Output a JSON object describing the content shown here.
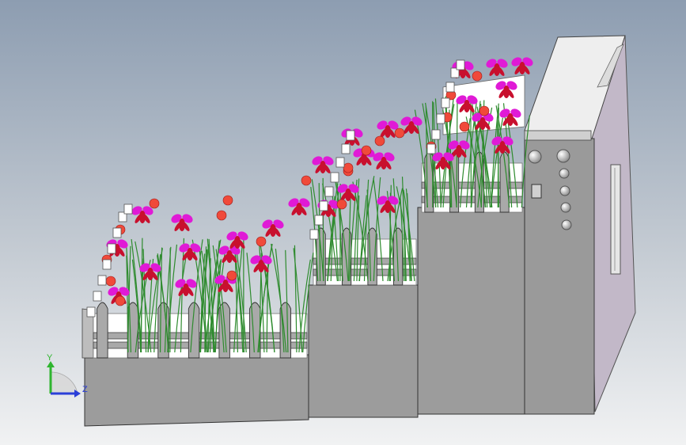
{
  "viewport": {
    "background_top": "#8d9db1",
    "background_bottom": "#f1f2f3"
  },
  "triad": {
    "y_label": "Y",
    "z_label": "Z",
    "y_color": "#2fb52f",
    "z_color": "#2a3fd8"
  },
  "model": {
    "body_color": "#9a9a9a",
    "face_dark_color": "#6f6f6f",
    "panel_color": "#eaeaea",
    "side_color": "#c2b8c8",
    "fence_color": "#a9a9a9",
    "leaf_color": "#2e8b2e",
    "flower_primary": "#e01ad6",
    "flower_secondary": "#c8102e",
    "bud_color": "#f04a3a",
    "button_count": 7
  }
}
